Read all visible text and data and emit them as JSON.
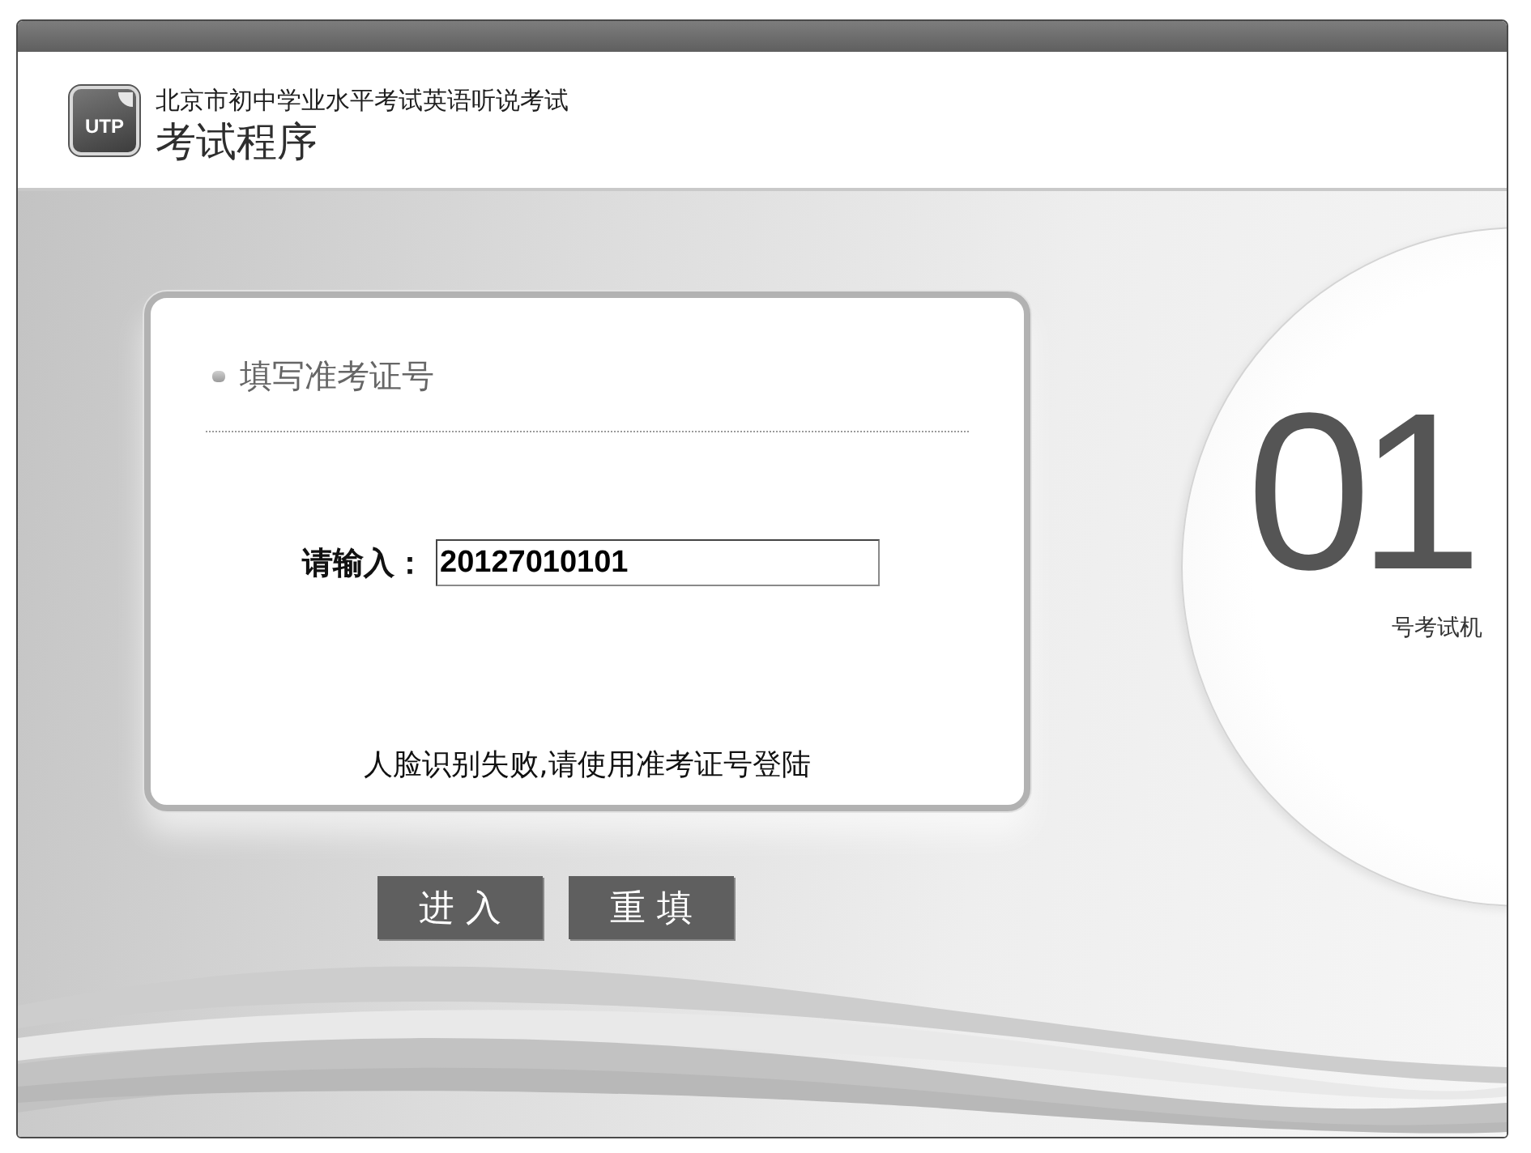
{
  "header": {
    "logo": "UTP",
    "subtitle": "北京市初中学业水平考试英语听说考试",
    "title": "考试程序"
  },
  "login_panel": {
    "heading": "填写准考证号",
    "field_label": "请输入：",
    "field_value": "20127010101",
    "message": "人脸识别失败,请使用准考证号登陆"
  },
  "buttons": [
    "进 入",
    "重 填"
  ],
  "machine": {
    "number": "01",
    "label": "号考试机"
  }
}
